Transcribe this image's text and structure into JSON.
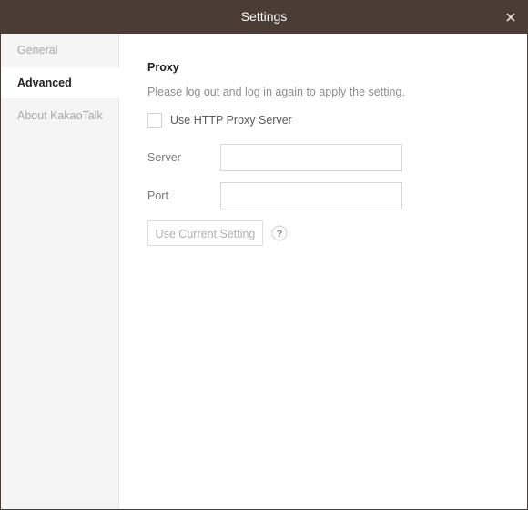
{
  "window": {
    "title": "Settings",
    "close_icon": "close-icon"
  },
  "sidebar": {
    "items": [
      {
        "label": "General",
        "active": false
      },
      {
        "label": "Advanced",
        "active": true
      },
      {
        "label": "About KakaoTalk",
        "active": false
      }
    ]
  },
  "proxy": {
    "section_title": "Proxy",
    "notice": "Please log out and log in again to apply the setting.",
    "use_http_proxy": {
      "label": "Use HTTP Proxy Server",
      "checked": false
    },
    "server": {
      "label": "Server",
      "value": ""
    },
    "port": {
      "label": "Port",
      "value": ""
    },
    "use_current_setting_label": "Use Current Setting",
    "help_icon": "question-mark-icon"
  },
  "colors": {
    "titlebar": "#4a3d35",
    "sidebar_bg": "#f5f5f5",
    "active_text": "#222222",
    "inactive_text": "#a8a8a8"
  }
}
